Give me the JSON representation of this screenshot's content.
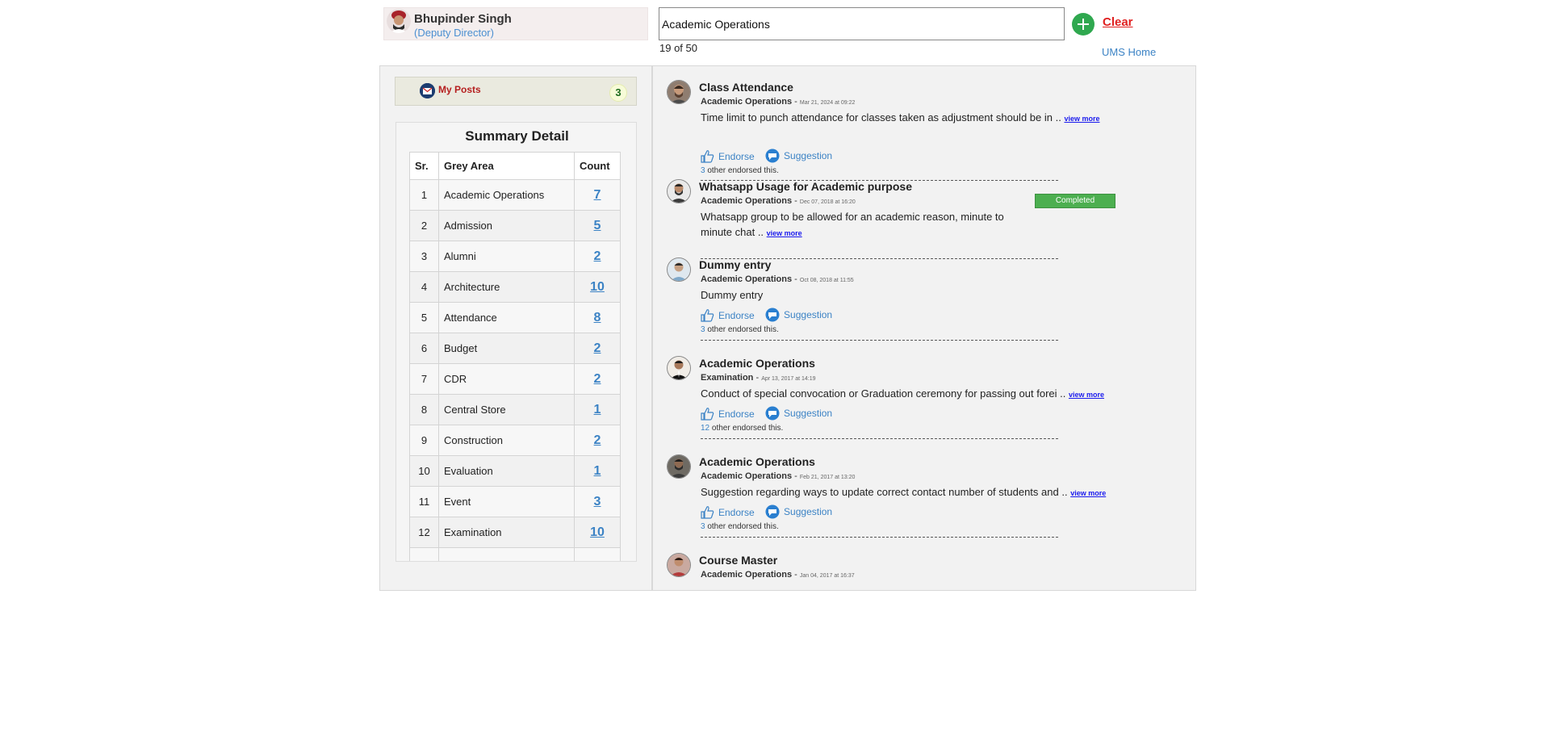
{
  "header": {
    "user_name": "Bhupinder Singh",
    "user_role": "(Deputy Director)",
    "search_value": "Academic Operations",
    "clear_label": "Clear",
    "result_count": "19 of 50",
    "ums_home_label": "UMS Home"
  },
  "sidebar": {
    "my_posts_label": "My Posts",
    "my_posts_count": "3",
    "summary_title": "Summary Detail",
    "columns": [
      "Sr.",
      "Grey Area",
      "Count"
    ],
    "rows": [
      {
        "sr": "1",
        "area": "Academic Operations",
        "count": "7"
      },
      {
        "sr": "2",
        "area": "Admission",
        "count": "5"
      },
      {
        "sr": "3",
        "area": "Alumni",
        "count": "2"
      },
      {
        "sr": "4",
        "area": "Architecture",
        "count": "10"
      },
      {
        "sr": "5",
        "area": "Attendance",
        "count": "8"
      },
      {
        "sr": "6",
        "area": "Budget",
        "count": "2"
      },
      {
        "sr": "7",
        "area": "CDR",
        "count": "2"
      },
      {
        "sr": "8",
        "area": "Central Store",
        "count": "1"
      },
      {
        "sr": "9",
        "area": "Construction",
        "count": "2"
      },
      {
        "sr": "10",
        "area": "Evaluation",
        "count": "1"
      },
      {
        "sr": "11",
        "area": "Event",
        "count": "3"
      },
      {
        "sr": "12",
        "area": "Examination",
        "count": "10"
      }
    ]
  },
  "posts": [
    {
      "title": "Class Attendance",
      "category": "Academic Operations",
      "separator": "-",
      "date": "Mar 21, 2024 at 09:22",
      "body_line1": "Time limit to punch attendance for classes taken as adjustment should be in ..",
      "body_line2": "",
      "view_more": "view more",
      "endorse_label": "Endorse",
      "suggestion_label": "Suggestion",
      "endorse_count": "3",
      "endorse_text": "other endorsed this.",
      "badge": ""
    },
    {
      "title": "Whatsapp Usage for Academic purpose",
      "category": "Academic Operations",
      "separator": "-",
      "date": "Dec 07, 2018 at 16:20",
      "body_line1": "Whatsapp group to be allowed for an academic reason, minute to",
      "body_line2": "minute chat ..",
      "view_more": "view more",
      "endorse_label": "",
      "suggestion_label": "",
      "endorse_count": "",
      "endorse_text": "",
      "badge": "Completed"
    },
    {
      "title": "Dummy entry",
      "category": "Academic Operations",
      "separator": "-",
      "date": "Oct 08, 2018 at 11:55",
      "body_line1": "Dummy entry",
      "body_line2": "",
      "view_more": "",
      "endorse_label": "Endorse",
      "suggestion_label": "Suggestion",
      "endorse_count": "3",
      "endorse_text": "other endorsed this.",
      "badge": ""
    },
    {
      "title": "Academic Operations",
      "category": "Examination",
      "separator": "-",
      "date": "Apr 13, 2017 at 14:19",
      "body_line1": "Conduct of special convocation or Graduation ceremony for passing out forei ..",
      "body_line2": "",
      "view_more": "view more",
      "endorse_label": "Endorse",
      "suggestion_label": "Suggestion",
      "endorse_count": "12",
      "endorse_text": "other endorsed this.",
      "badge": ""
    },
    {
      "title": "Academic Operations",
      "category": "Academic Operations",
      "separator": "-",
      "date": "Feb 21, 2017 at 13:20",
      "body_line1": "Suggestion regarding ways to update correct contact number of students and ..",
      "body_line2": "",
      "view_more": "view more",
      "endorse_label": "Endorse",
      "suggestion_label": "Suggestion",
      "endorse_count": "3",
      "endorse_text": "other endorsed this.",
      "badge": ""
    },
    {
      "title": "Course Master",
      "category": "Academic Operations",
      "separator": "-",
      "date": "Jan 04, 2017 at 16:37",
      "body_line1": "",
      "body_line2": "",
      "view_more": "",
      "endorse_label": "",
      "suggestion_label": "",
      "endorse_count": "",
      "endorse_text": "",
      "badge": ""
    }
  ],
  "colors": {
    "accent_blue": "#3c83c5",
    "clear_red": "#e02020",
    "my_posts_red": "#b51f1f",
    "completed_green": "#4caf50",
    "add_green": "#2fa84f"
  }
}
